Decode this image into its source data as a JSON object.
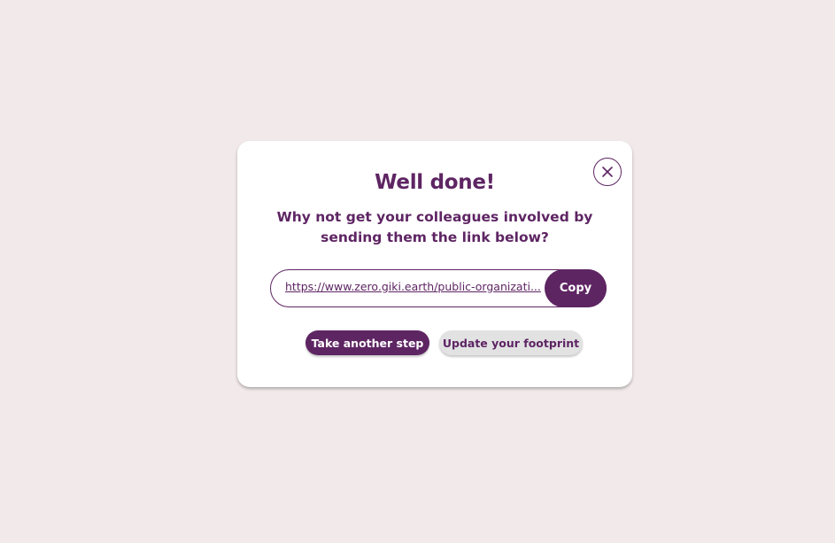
{
  "modal": {
    "title": "Well done!",
    "subtitle": "Why not get your colleagues involved by sending them the link below?",
    "share_link": "https://www.zero.giki.earth/public-organizati...",
    "copy_label": "Copy",
    "primary_button_label": "Take another step",
    "secondary_button_label": "Update your footprint",
    "close_icon": "close-icon"
  },
  "colors": {
    "brand": "#5e2563",
    "background": "#f1e9ea",
    "secondary_button": "#e2e2e3"
  }
}
